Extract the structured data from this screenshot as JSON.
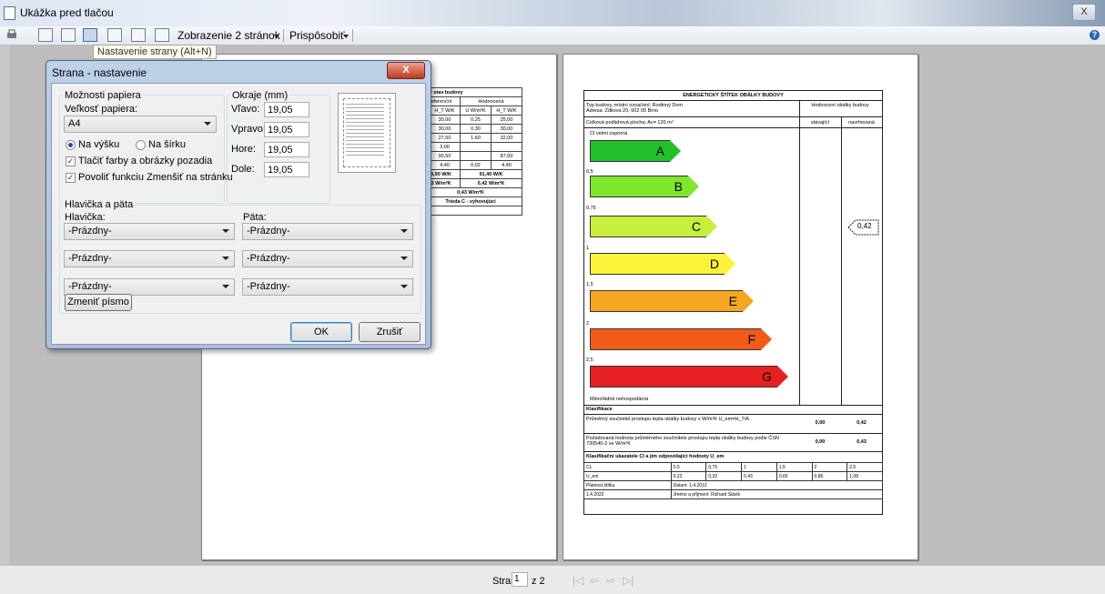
{
  "window": {
    "title": "Ukážka pred tlačou",
    "close": "X"
  },
  "toolbar": {
    "view_two": "Zobrazenie 2 stránok",
    "fit": "Prispôsobiť",
    "tooltip": "Nastavenie strany (Alt+N)"
  },
  "status": {
    "page_label": "Strana",
    "page_value": "1",
    "of_label": "z 2"
  },
  "left_page": {
    "header_title": "nový stav budovy",
    "col_ref": "Referenční",
    "col_eval": "Hodnocená",
    "units": [
      "H_T W/K",
      "U W/m²K",
      "H_T W/K"
    ],
    "rows": [
      [
        "0",
        "30,00",
        "0,25",
        "25,00"
      ],
      [
        "0",
        "30,00",
        "0,30",
        "30,00"
      ],
      [
        "0",
        "27,50",
        "1,60",
        "32,00"
      ],
      [
        "0",
        "3,00",
        "",
        ""
      ],
      [
        "",
        "90,50",
        "",
        "87,00"
      ],
      [
        "2",
        "4,40",
        "0,02",
        "4,40"
      ]
    ],
    "sum1": [
      "94,90 W/K",
      "91,40 W/K"
    ],
    "sum2": [
      "43 W/m²K",
      "0,42 W/m²K"
    ],
    "total": "0,43 W/m²K",
    "class": "Trieda C - vyhovujúci"
  },
  "right_page": {
    "title": "ENERGETICKÝ ŠTÍTEK OBÁLKY BUDOVY",
    "type_line": "Typ budovy, místní označení: Rodinný Dom",
    "address_line": "Adresa: Zdkova 20, 602 00 Brno",
    "eval_header": "Hodnocení obálky budovy",
    "floor_area": "Celková podlahová plocha: Ac= 120 m²",
    "col_existing": "stávající",
    "col_proposed": "navrhovaná",
    "very_efficient": "CI velmi úsporná",
    "very_inefficient": "Mimořádně nehospodárná",
    "bar_letters": [
      "A",
      "B",
      "C",
      "D",
      "E",
      "F",
      "G"
    ],
    "bar_colors": [
      "#22c02a",
      "#7ee62c",
      "#c8ef3c",
      "#fdf23a",
      "#f5a623",
      "#f25a1a",
      "#e62020"
    ],
    "thresholds": [
      "0,5",
      "0,75",
      "1",
      "1,5",
      "2",
      "2,5"
    ],
    "marker": "0,42",
    "classification": "Klasifikace",
    "avg_text": "Průměrný součinitel prostupu tepla obálky budovy v W/m²K U_em=H_T/A",
    "avg_existing": "0,00",
    "avg_proposed": "0,42",
    "req_text": "Požadovaná hodnota průměrného součinitele prostupu tepla obálky budovy podle ČSN 730540-2 ve W/m²K",
    "req_existing": "0,00",
    "req_proposed": "0,43",
    "class_table_title": "Klasifikační ukazatele CI a jim odpovídající hodnoty U_em",
    "ci_row": [
      "CL",
      "0,5",
      "0,75",
      "1",
      "1,5",
      "2",
      "2,5"
    ],
    "uem_row": [
      "U_em",
      "0,22",
      "0,32",
      "0,43",
      "0,65",
      "0,86",
      "1,08"
    ],
    "validity": "Platnost štítku",
    "date": "Datum: 1.4.2012",
    "valid_until": "1.4.2022",
    "name": "Jméno a příjmení: Richard Slávik"
  },
  "dialog": {
    "title": "Strana - nastavenie",
    "paper_group": "Možnosti papiera",
    "paper_size_label": "Veľkosť papiera:",
    "paper_size_value": "A4",
    "portrait": "Na výšku",
    "landscape": "Na šírku",
    "print_bg": "Tlačiť farby a obrázky pozadia",
    "shrink": "Povoliť funkciu Zmenšiť na stránku",
    "margins_group": "Okraje (mm)",
    "left_label": "Vľavo:",
    "left_value": "19,05",
    "right_label": "Vpravo:",
    "right_value": "19,05",
    "top_label": "Hore:",
    "top_value": "19,05",
    "bottom_label": "Dole:",
    "bottom_value": "19,05",
    "hf_group": "Hlavička a päta",
    "header_label": "Hlavička:",
    "footer_label": "Päta:",
    "empty": "-Prázdny-",
    "font_button": "Zmeniť písmo",
    "ok": "OK",
    "cancel": "Zrušiť"
  }
}
